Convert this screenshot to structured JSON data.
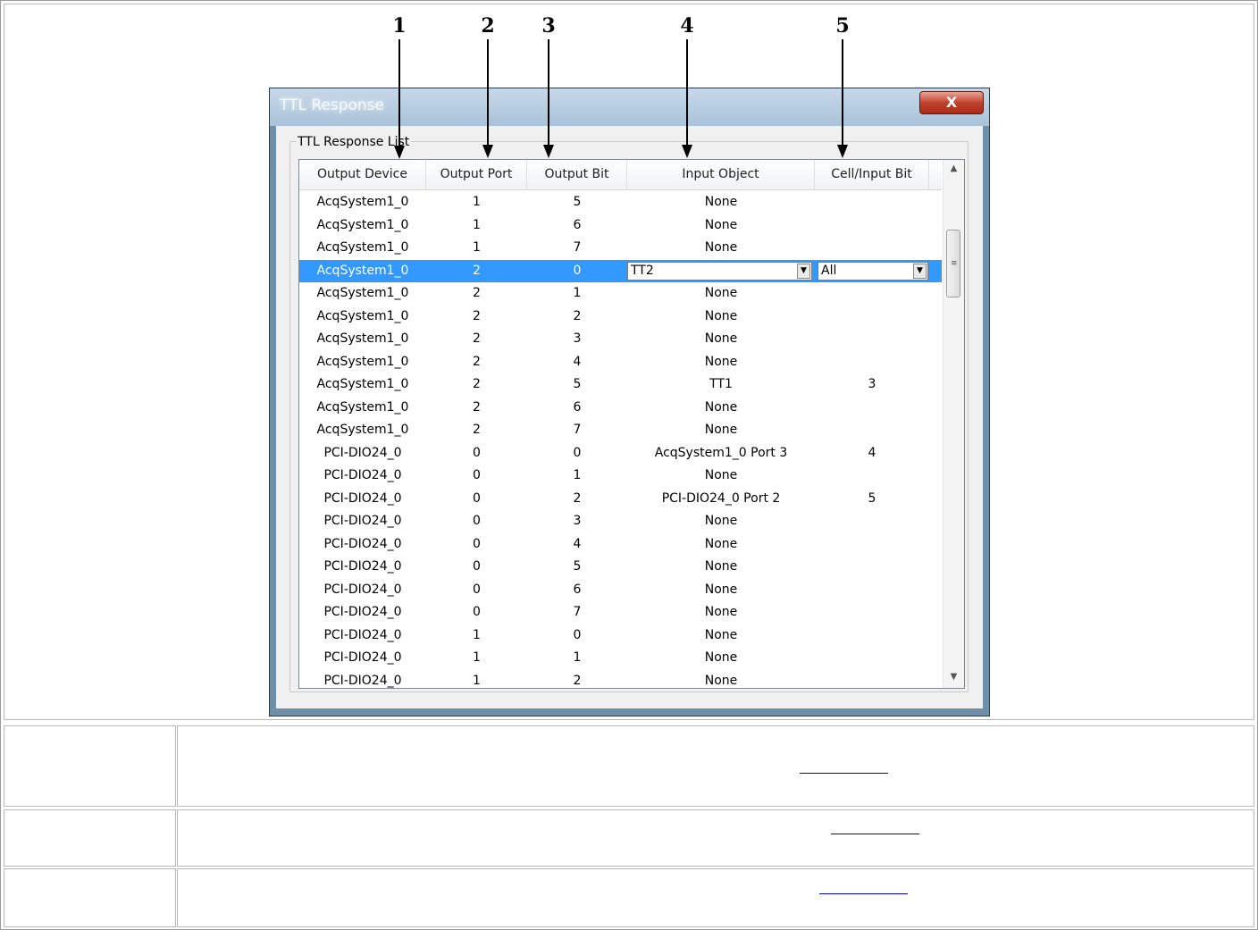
{
  "callouts": [
    "1",
    "2",
    "3",
    "4",
    "5"
  ],
  "window": {
    "title": "TTL Response",
    "close_label": "X",
    "group_label": "TTL Response List"
  },
  "list": {
    "columns": [
      "Output Device",
      "Output Port",
      "Output Bit",
      "Input Object",
      "Cell/Input Bit"
    ],
    "rows": [
      {
        "device": "AcqSystem1_0",
        "port": "1",
        "bit": "5",
        "input": "None",
        "cell": ""
      },
      {
        "device": "AcqSystem1_0",
        "port": "1",
        "bit": "6",
        "input": "None",
        "cell": ""
      },
      {
        "device": "AcqSystem1_0",
        "port": "1",
        "bit": "7",
        "input": "None",
        "cell": ""
      },
      {
        "device": "AcqSystem1_0",
        "port": "2",
        "bit": "0",
        "input": "TT2",
        "cell": "All"
      },
      {
        "device": "AcqSystem1_0",
        "port": "2",
        "bit": "1",
        "input": "None",
        "cell": ""
      },
      {
        "device": "AcqSystem1_0",
        "port": "2",
        "bit": "2",
        "input": "None",
        "cell": ""
      },
      {
        "device": "AcqSystem1_0",
        "port": "2",
        "bit": "3",
        "input": "None",
        "cell": ""
      },
      {
        "device": "AcqSystem1_0",
        "port": "2",
        "bit": "4",
        "input": "None",
        "cell": ""
      },
      {
        "device": "AcqSystem1_0",
        "port": "2",
        "bit": "5",
        "input": "TT1",
        "cell": "3"
      },
      {
        "device": "AcqSystem1_0",
        "port": "2",
        "bit": "6",
        "input": "None",
        "cell": ""
      },
      {
        "device": "AcqSystem1_0",
        "port": "2",
        "bit": "7",
        "input": "None",
        "cell": ""
      },
      {
        "device": "PCI-DIO24_0",
        "port": "0",
        "bit": "0",
        "input": "AcqSystem1_0 Port 3",
        "cell": "4"
      },
      {
        "device": "PCI-DIO24_0",
        "port": "0",
        "bit": "1",
        "input": "None",
        "cell": ""
      },
      {
        "device": "PCI-DIO24_0",
        "port": "0",
        "bit": "2",
        "input": "PCI-DIO24_0 Port 2",
        "cell": "5"
      },
      {
        "device": "PCI-DIO24_0",
        "port": "0",
        "bit": "3",
        "input": "None",
        "cell": ""
      },
      {
        "device": "PCI-DIO24_0",
        "port": "0",
        "bit": "4",
        "input": "None",
        "cell": ""
      },
      {
        "device": "PCI-DIO24_0",
        "port": "0",
        "bit": "5",
        "input": "None",
        "cell": ""
      },
      {
        "device": "PCI-DIO24_0",
        "port": "0",
        "bit": "6",
        "input": "None",
        "cell": ""
      },
      {
        "device": "PCI-DIO24_0",
        "port": "0",
        "bit": "7",
        "input": "None",
        "cell": ""
      },
      {
        "device": "PCI-DIO24_0",
        "port": "1",
        "bit": "0",
        "input": "None",
        "cell": ""
      },
      {
        "device": "PCI-DIO24_0",
        "port": "1",
        "bit": "1",
        "input": "None",
        "cell": ""
      },
      {
        "device": "PCI-DIO24_0",
        "port": "1",
        "bit": "2",
        "input": "None",
        "cell": ""
      }
    ],
    "selected_row": 3
  },
  "icons": {
    "scroll_up": "scroll-up-arrow-icon",
    "scroll_down": "scroll-down-arrow-icon",
    "grip": "scrollbar-grip-icon",
    "dropdown": "dropdown-arrow-icon"
  },
  "colors": {
    "selection": "#3399ff",
    "close_button": "#c0432f",
    "link": "#0000cc"
  }
}
